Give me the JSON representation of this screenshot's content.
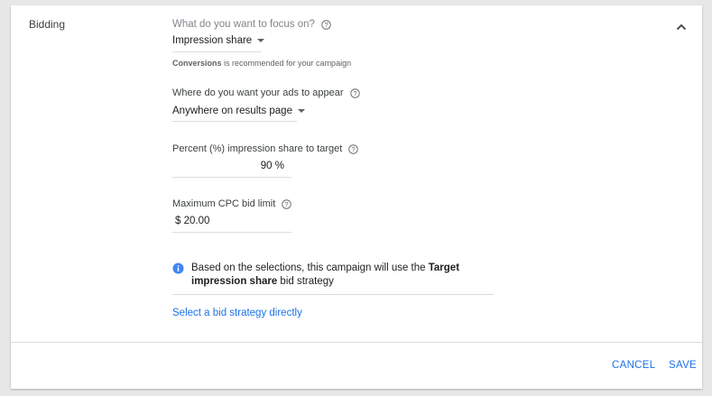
{
  "section": {
    "label": "Bidding"
  },
  "focus": {
    "label": "What do you want to focus on?",
    "value": "Impression share",
    "hint_bold": "Conversions",
    "hint_rest": " is recommended for your campaign"
  },
  "location": {
    "label": "Where do you want your ads to appear",
    "value": "Anywhere on results page"
  },
  "percent": {
    "label": "Percent (%) impression share to target",
    "value": "90 %"
  },
  "max_cpc": {
    "label": "Maximum CPC bid limit",
    "value": "$ 20.00"
  },
  "info": {
    "prefix": "Based on the selections, this campaign will use the ",
    "bold": "Target impression share",
    "suffix": " bid strategy"
  },
  "link": {
    "label": "Select a bid strategy directly"
  },
  "footer": {
    "cancel_label": "CANCEL",
    "save_label": "SAVE"
  },
  "icons": {
    "collapse": "chevron-up-icon",
    "help": "help-circle-icon",
    "info": "info-icon",
    "dropdown": "caret-down-icon"
  },
  "colors": {
    "accent": "#1a73e8",
    "text": "#202124",
    "muted": "#80868b",
    "divider": "#dadce0",
    "background": "#e7e7e7"
  }
}
